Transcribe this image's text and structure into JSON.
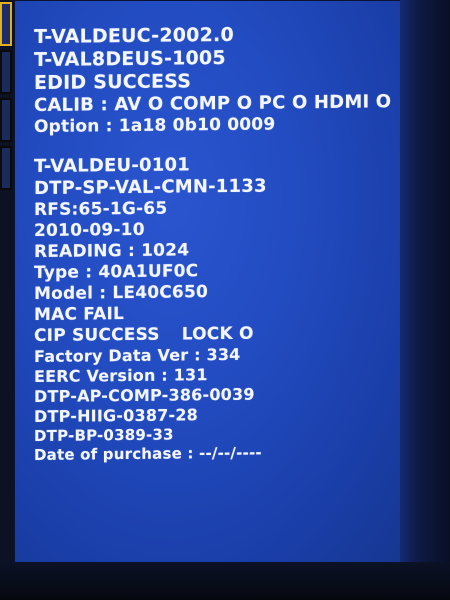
{
  "service_menu": {
    "lines": [
      "T-VALDEUC-2002.0",
      "T-VAL8DEUS-1005",
      "EDID SUCCESS",
      "CALIB : AV O COMP O PC O HDMI O",
      "Option : 1a18 0b10 0009",
      "T-VALDEU-0101",
      "DTP-SP-VAL-CMN-1133",
      "RFS:65-1G-65",
      "2010-09-10",
      "READING : 1024",
      "Type : 40A1UF0C",
      "Model : LE40C650",
      "MAC FAIL",
      "CIP SUCCESS",
      "Factory Data Ver : 334",
      "EERC Version : 131",
      "DTP-AP-COMP-386-0039",
      "DTP-HIIG-0387-28",
      "DTP-BP-0389-33",
      "Date of purchase : --/--/----"
    ],
    "lock_status": "LOCK O"
  },
  "colors": {
    "panel_blue": "#2450c6",
    "text": "#f4f6ff",
    "selection_border": "#e0b020"
  }
}
